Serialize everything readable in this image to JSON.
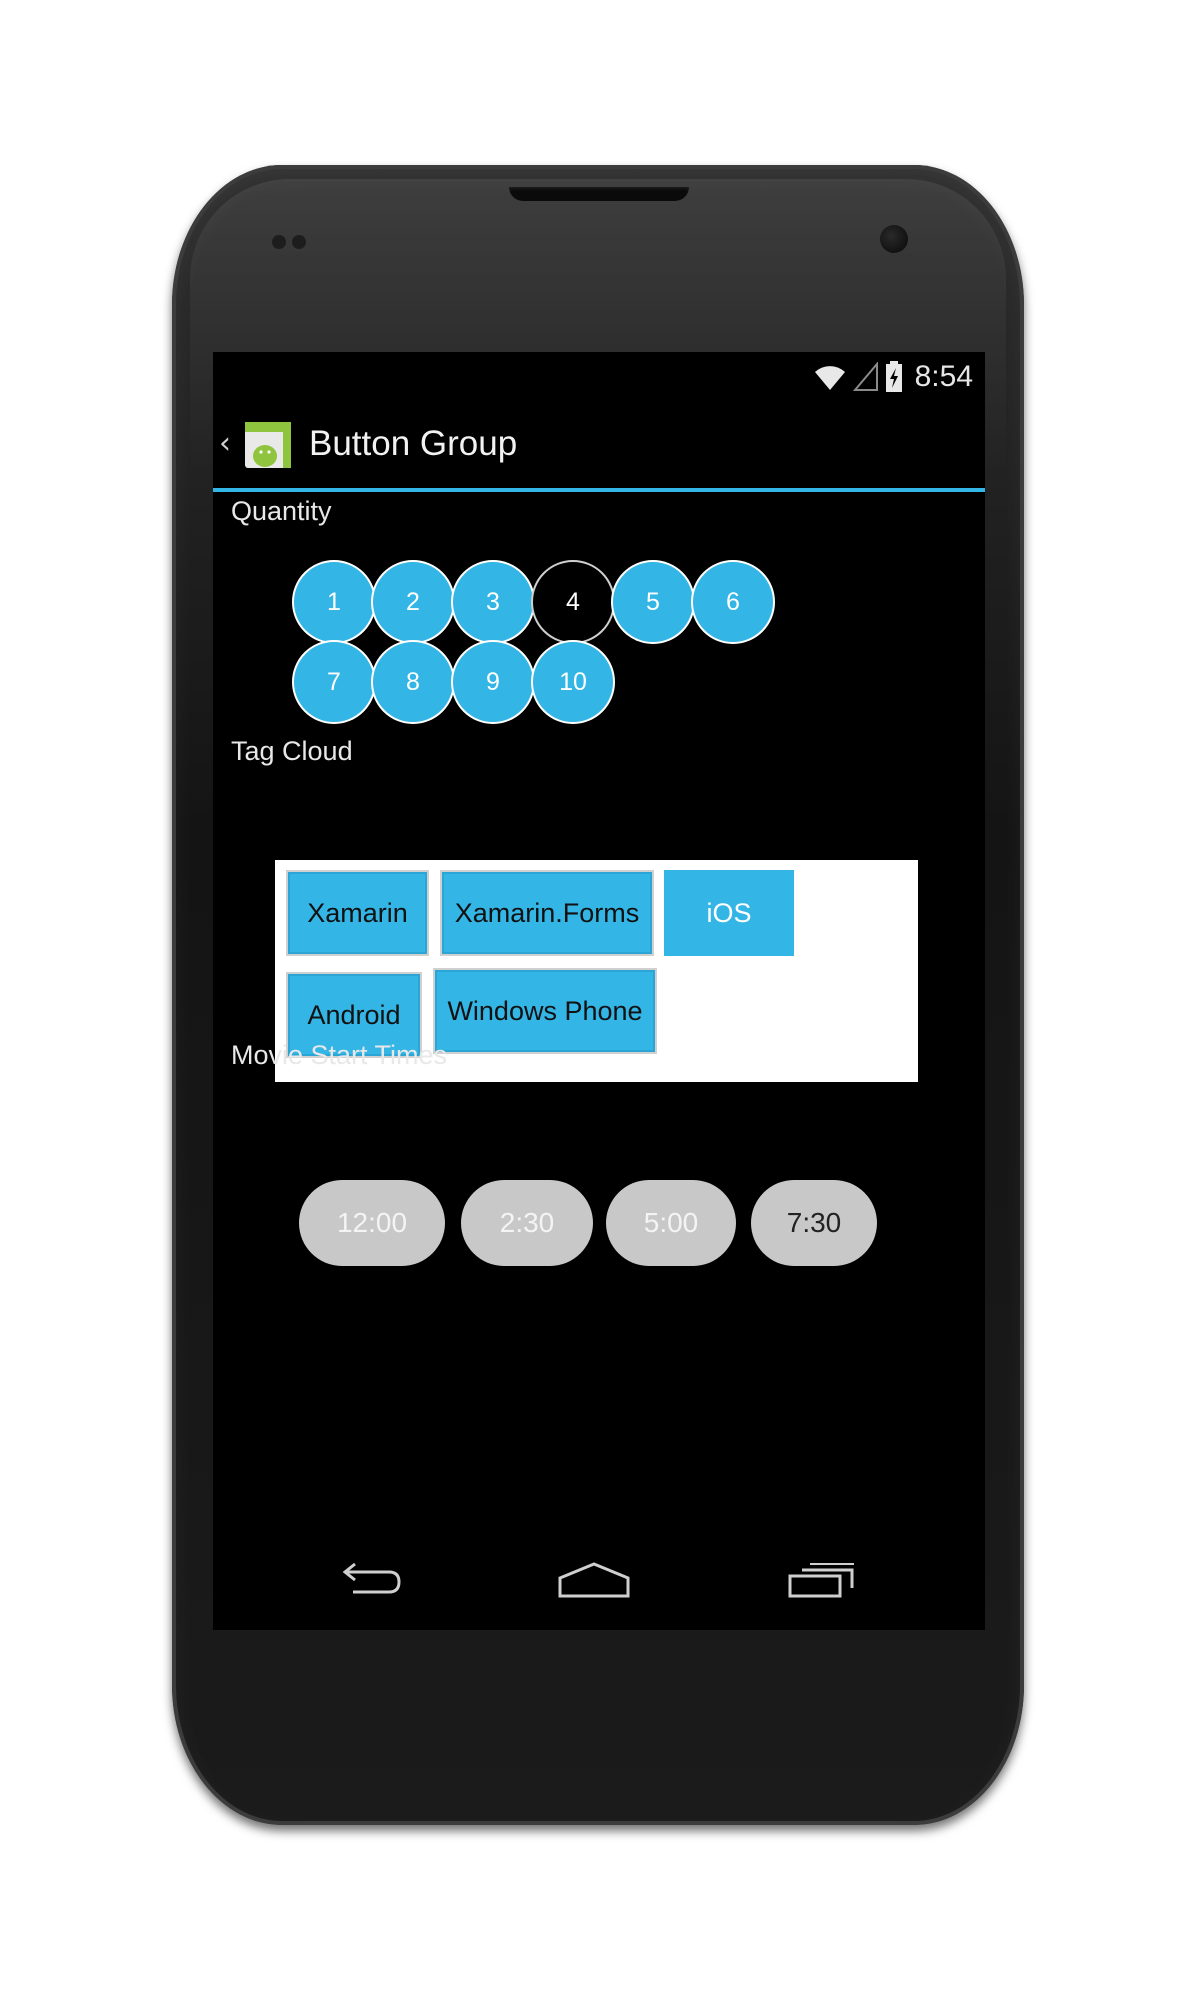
{
  "status_bar": {
    "time": "8:54",
    "icons": [
      "wifi-icon",
      "signal-icon",
      "battery-charging-icon"
    ]
  },
  "action_bar": {
    "up_glyph": "‹",
    "title": "Button Group",
    "app_icon": "android-app-icon"
  },
  "quantity": {
    "label": "Quantity",
    "options": [
      "1",
      "2",
      "3",
      "4",
      "5",
      "6",
      "7",
      "8",
      "9",
      "10"
    ],
    "selected": "4"
  },
  "tag_cloud": {
    "label": "Tag Cloud",
    "tags": [
      "Xamarin",
      "Xamarin.Forms",
      "iOS",
      "Android",
      "Windows Phone"
    ],
    "selected": "iOS"
  },
  "movie_times": {
    "label": "Movie Start Times",
    "times": [
      "12:00",
      "2:30",
      "5:00",
      "7:30"
    ],
    "selected": "7:30"
  },
  "nav_bar": {
    "icons": [
      "back-icon",
      "home-icon",
      "recent-apps-icon"
    ]
  },
  "colors": {
    "accent": "#33b5e5",
    "screen_bg": "#000000",
    "pill_bg": "#c8c8c8"
  }
}
